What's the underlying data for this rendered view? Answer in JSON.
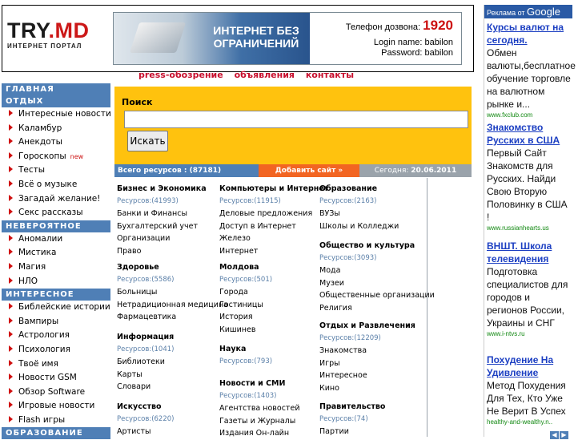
{
  "header": {
    "logo_main": "TRY",
    "logo_dot": ".MD",
    "logo_sub": "ИНТЕРНЕТ ПОРТАЛ",
    "banner_slogan": "ИНТЕРНЕТ БЕЗ ОГРАНИЧЕНИЙ",
    "banner_phone_label": "Телефон дозвона: ",
    "banner_phone_number": "1920",
    "banner_login": "Login name: babilon",
    "banner_password": "Password: babilon"
  },
  "topnav": {
    "items": [
      "press-обозрение",
      "объявления",
      "контакты"
    ]
  },
  "sidebar": {
    "sections": [
      {
        "label": "ГЛАВНАЯ",
        "items": []
      },
      {
        "label": "ОТДЫХ",
        "items": [
          "Интересные новости",
          "Каламбур",
          "Анекдоты",
          "Гороскопы",
          "Тесты",
          "Всё о музыке",
          "Загадай желание!",
          "Секс рассказы"
        ]
      },
      {
        "label": "НЕВЕРОЯТНОЕ",
        "items": [
          "Аномалии",
          "Мистика",
          "Магия",
          "НЛО"
        ]
      },
      {
        "label": "ИНТЕРЕСНОЕ",
        "items": [
          "Библейские истории",
          "Вампиры",
          "Астрология",
          "Психология",
          "Твоё имя",
          "Новости GSM",
          "Обзор Software",
          "Игровые новости",
          "Flash игры"
        ]
      },
      {
        "label": "ОБРАЗОВАНИЕ",
        "items": []
      }
    ],
    "new_badge": "new"
  },
  "search": {
    "title": "Поиск",
    "value": "",
    "button_label": "Искать"
  },
  "statusbar": {
    "total_label": "Всего ресурсов : (87181)",
    "add_label": "Добавить сайт »",
    "date_label": "Сегодня: ",
    "date_value": "20.06.2011"
  },
  "directory": {
    "columns": [
      [
        {
          "title": "Бизнес и Экономика",
          "count": "Ресурсов:(41993)",
          "links": [
            "Банки и Финансы",
            "Бухгалтерский учет",
            "Организации",
            "Право"
          ]
        },
        {
          "title": "Здоровье",
          "count": "Ресурсов:(5586)",
          "links": [
            "Больницы",
            "Нетрадиционная медицина",
            "Фармацевтика"
          ]
        },
        {
          "title": "Информация",
          "count": "Ресурсов:(1041)",
          "links": [
            "Библиотеки",
            "Карты",
            "Словари"
          ]
        },
        {
          "title": "Искусство",
          "count": "Ресурсов:(6220)",
          "links": [
            "Артисты"
          ]
        }
      ],
      [
        {
          "title": "Компьютеры и Интернет",
          "count": "Ресурсов:(11915)",
          "links": [
            "Деловые предложения",
            "Доступ в Интернет",
            "Железо",
            "Интернет"
          ]
        },
        {
          "title": "Молдова",
          "count": "Ресурсов:(501)",
          "links": [
            "Города",
            "Гостиницы",
            "История",
            "Кишинев"
          ]
        },
        {
          "title": "Наука",
          "count": "Ресурсов:(793)",
          "links": []
        },
        {
          "title": "Новости и СМИ",
          "count": "Ресурсов:(1403)",
          "links": [
            "Агентства новостей",
            "Газеты и Журналы",
            "Издания Он-лайн"
          ]
        }
      ],
      [
        {
          "title": "Образование",
          "count": "Ресурсов:(2163)",
          "links": [
            "ВУЗы",
            "Школы и Колледжи"
          ]
        },
        {
          "title": "Общество и культура",
          "count": "Ресурсов:(3093)",
          "links": [
            "Мода",
            "Музеи",
            "Общественные организации",
            "Религия"
          ]
        },
        {
          "title": "Отдых и Развлечения",
          "count": "Ресурсов:(12209)",
          "links": [
            "Знакомства",
            "Игры",
            "Интересное",
            "Кино"
          ]
        },
        {
          "title": "Правительство",
          "count": "Ресурсов:(74)",
          "links": [
            "Партии"
          ]
        }
      ]
    ]
  },
  "ads": {
    "header_label": "Реклама от ",
    "header_brand": "Google",
    "items": [
      {
        "title": "Курсы валют на сегодня.",
        "body": "Обмен валюты,бесплатное обучение торговле на валютном рынке и...",
        "url": "www.fxclub.com"
      },
      {
        "title": "Знакомство Русских в США",
        "body": "Первый Сайт Знакомств для Русских. Найди Свою Вторую Половинку в США !",
        "url": "www.russianhearts.us"
      },
      {
        "title": "ВНШТ. Школа телевидения",
        "body": "Подготовка специалистов для городов и регионов России, Украины и СНГ",
        "url": "www.i-ntvs.ru"
      },
      {
        "title": "Похудение На Удивление",
        "body": "Метод Похудения Для Тех, Кто Уже Не Верит В Успех",
        "url": "healthy-and-wealthy.n.."
      }
    ]
  }
}
